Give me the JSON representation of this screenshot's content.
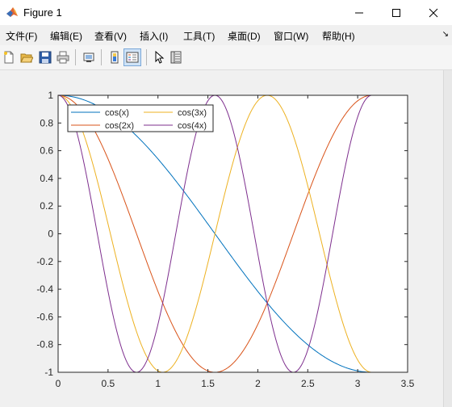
{
  "window": {
    "title": "Figure 1"
  },
  "menu": {
    "items": [
      {
        "label": "文件(F)"
      },
      {
        "label": "编辑(E)"
      },
      {
        "label": "查看(V)"
      },
      {
        "label": "插入(I)"
      },
      {
        "label": "工具(T)"
      },
      {
        "label": "桌面(D)"
      },
      {
        "label": "窗口(W)"
      },
      {
        "label": "帮助(H)"
      }
    ],
    "overflow_icon": "arrow-icon"
  },
  "toolbar": {
    "buttons": [
      {
        "icon": "new-figure-icon"
      },
      {
        "icon": "open-icon"
      },
      {
        "icon": "save-icon"
      },
      {
        "icon": "print-icon"
      },
      {
        "icon": "link-plot-icon"
      },
      {
        "icon": "insert-colorbar-icon"
      },
      {
        "icon": "insert-legend-icon"
      },
      {
        "icon": "pointer-icon"
      },
      {
        "icon": "property-inspector-icon"
      }
    ]
  },
  "chart_data": {
    "type": "line",
    "title": "",
    "xlabel": "",
    "ylabel": "",
    "xlim": [
      0,
      3.5
    ],
    "ylim": [
      -1,
      1
    ],
    "x_ticks": [
      "0",
      "0.5",
      "1",
      "1.5",
      "2",
      "2.5",
      "3",
      "3.5"
    ],
    "y_ticks": [
      "-1",
      "-0.8",
      "-0.6",
      "-0.4",
      "-0.2",
      "0",
      "0.2",
      "0.4",
      "0.6",
      "0.8",
      "1"
    ],
    "x_domain": [
      0,
      3.1416
    ],
    "grid": false,
    "legend_placement": "top-left",
    "legend_columns": 2,
    "series": [
      {
        "name": "cos(x)",
        "multiplier": 1,
        "color": "#0072bd"
      },
      {
        "name": "cos(2x)",
        "multiplier": 2,
        "color": "#d95319"
      },
      {
        "name": "cos(3x)",
        "multiplier": 3,
        "color": "#edb120"
      },
      {
        "name": "cos(4x)",
        "multiplier": 4,
        "color": "#7e2f8e"
      }
    ]
  }
}
